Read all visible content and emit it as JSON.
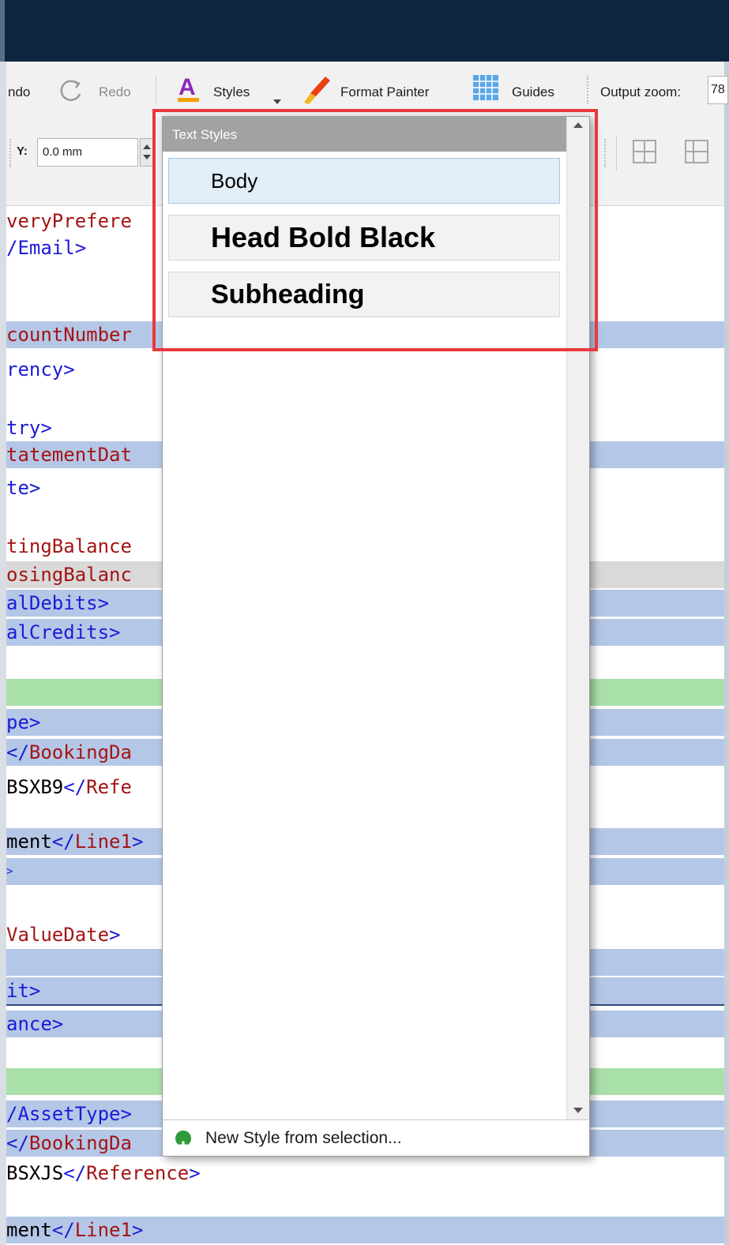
{
  "toolbar": {
    "undo_label": "ndo",
    "redo_label": "Redo",
    "styles_label": "Styles",
    "format_painter_label": "Format Painter",
    "guides_label": "Guides",
    "output_zoom_label": "Output zoom:",
    "output_zoom_value": "78",
    "y_label": "Y:",
    "y_value": "0.0 mm"
  },
  "editor_lines": [
    {
      "segments": [
        {
          "text": "veryPrefere",
          "color": "red"
        }
      ],
      "highlight": "none"
    },
    {
      "segments": [
        {
          "text": "/Email>",
          "color": "blue"
        }
      ],
      "highlight": "none"
    },
    {
      "segments": [
        {
          "text": "countNumber",
          "color": "red"
        }
      ],
      "highlight": "blue"
    },
    {
      "segments": [
        {
          "text": "rency>",
          "color": "blue"
        }
      ],
      "highlight": "none"
    },
    {
      "segments": [
        {
          "text": "try>",
          "color": "blue"
        }
      ],
      "highlight": "none"
    },
    {
      "segments": [
        {
          "text": "tatementDat",
          "color": "red"
        }
      ],
      "highlight": "blue"
    },
    {
      "segments": [
        {
          "text": "te>",
          "color": "blue"
        }
      ],
      "highlight": "none"
    },
    {
      "segments": [
        {
          "text": "tingBalance",
          "color": "red"
        }
      ],
      "highlight": "none"
    },
    {
      "segments": [
        {
          "text": "osingBalanc",
          "color": "red"
        }
      ],
      "highlight": "gray"
    },
    {
      "segments": [
        {
          "text": "alDebits>",
          "color": "blue"
        }
      ],
      "highlight": "blue"
    },
    {
      "segments": [
        {
          "text": "alCredits>",
          "color": "blue"
        }
      ],
      "highlight": "blue"
    },
    {
      "segments": [
        {
          "text": "",
          "color": "black"
        }
      ],
      "highlight": "green"
    },
    {
      "segments": [
        {
          "text": "pe>",
          "color": "blue"
        }
      ],
      "highlight": "blue"
    },
    {
      "segments": [
        {
          "text": "</",
          "color": "blue"
        },
        {
          "text": "BookingDa",
          "color": "red"
        }
      ],
      "highlight": "blue"
    },
    {
      "segments": [
        {
          "text": "BSXB9",
          "color": "black"
        },
        {
          "text": "</",
          "color": "blue"
        },
        {
          "text": "Refe",
          "color": "red"
        }
      ],
      "highlight": "none"
    },
    {
      "segments": [
        {
          "text": "ment",
          "color": "black"
        },
        {
          "text": "</",
          "color": "blue"
        },
        {
          "text": "Line1",
          "color": "red"
        },
        {
          "text": ">",
          "color": "blue"
        }
      ],
      "highlight": "blue"
    },
    {
      "segments": [
        {
          "text": ">",
          "color": "blue"
        }
      ],
      "highlight": "blue"
    },
    {
      "segments": [
        {
          "text": "ValueDate",
          "color": "red"
        },
        {
          "text": ">",
          "color": "blue"
        }
      ],
      "highlight": "none"
    },
    {
      "segments": [
        {
          "text": "",
          "color": "black"
        }
      ],
      "highlight": "blue"
    },
    {
      "segments": [
        {
          "text": "it>",
          "color": "blue"
        }
      ],
      "highlight": "blue"
    },
    {
      "segments": [
        {
          "text": "ance>",
          "color": "blue"
        }
      ],
      "highlight": "blue"
    },
    {
      "segments": [
        {
          "text": "",
          "color": "black"
        }
      ],
      "highlight": "green"
    },
    {
      "segments": [
        {
          "text": "/AssetType>",
          "color": "blue"
        }
      ],
      "highlight": "blue"
    },
    {
      "segments": [
        {
          "text": "</",
          "color": "blue"
        },
        {
          "text": "BookingDa",
          "color": "red"
        }
      ],
      "highlight": "blue"
    },
    {
      "segments": [
        {
          "text": "BSXJS",
          "color": "black"
        },
        {
          "text": "</",
          "color": "blue"
        },
        {
          "text": "Reference",
          "color": "red"
        },
        {
          "text": ">",
          "color": "blue"
        }
      ],
      "highlight": "none"
    },
    {
      "segments": [
        {
          "text": "ment",
          "color": "black"
        },
        {
          "text": "</",
          "color": "blue"
        },
        {
          "text": "Line1",
          "color": "red"
        },
        {
          "text": ">",
          "color": "blue"
        }
      ],
      "highlight": "blue"
    }
  ],
  "text_styles": {
    "title": "Text Styles",
    "items": [
      {
        "label": "Body"
      },
      {
        "label": "Head Bold Black"
      },
      {
        "label": "Subheading"
      }
    ],
    "new_style_label": "New Style from selection..."
  },
  "colors": {
    "highlight_box": "#e8383d",
    "title_bar": "#0d2640",
    "selected_style": "#e1edf7",
    "code_red": "#a31515",
    "code_blue": "#1b1bd6"
  }
}
